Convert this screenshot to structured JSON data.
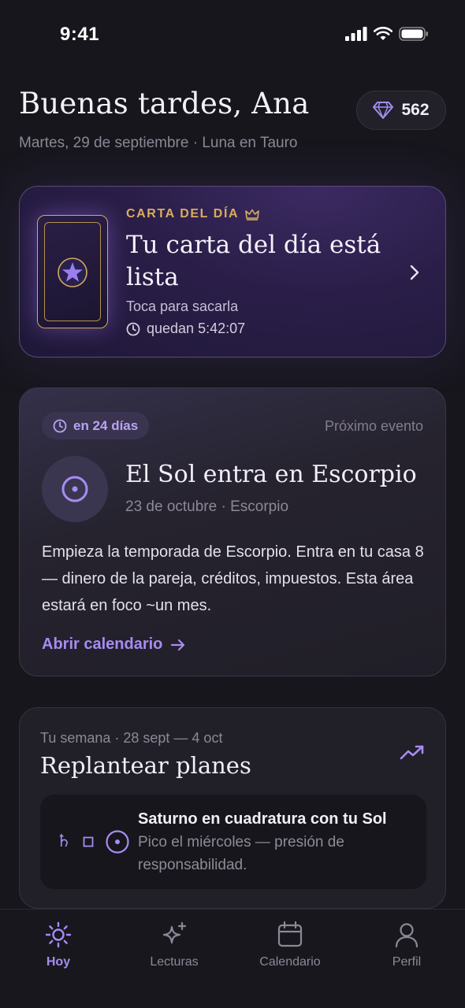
{
  "status_bar": {
    "time": "9:41"
  },
  "header": {
    "greeting": "Buenas tardes, Ana",
    "date_line": "Martes, 29 de septiembre · Luna en Tauro",
    "gems": "562"
  },
  "daily_card": {
    "kicker": "CARTA DEL DÍA",
    "title": "Tu carta del día está lista",
    "subtitle": "Toca para sacarla",
    "timer": "quedan 5:42:07"
  },
  "event_card": {
    "badge": "en 24 días",
    "kind": "Próximo evento",
    "title": "El Sol entra en Escorpio",
    "meta": "23 de octubre · Escorpio",
    "description": "Empieza la temporada de Escorpio. Entra en tu casa 8 — dinero de la pareja, créditos, impuestos. Esta área estará en foco ~un mes.",
    "link": "Abrir calendario"
  },
  "week_card": {
    "range": "Tu semana · 28 sept — 4 oct",
    "title": "Replantear planes",
    "transit": {
      "symbols": [
        "♄",
        "□",
        "☉"
      ],
      "title": "Saturno en cuadratura con tu Sol",
      "description": "Pico el miércoles — presión de responsabilidad."
    }
  },
  "nav": {
    "items": [
      {
        "label": "Hoy",
        "icon": "sun-icon",
        "active": true
      },
      {
        "label": "Lecturas",
        "icon": "sparkle-icon",
        "active": false
      },
      {
        "label": "Calendario",
        "icon": "calendar-icon",
        "active": false
      },
      {
        "label": "Perfil",
        "icon": "user-icon",
        "active": false
      }
    ]
  },
  "colors": {
    "accent": "#a68cf2",
    "gold": "#d9ad5e",
    "background": "#17161d"
  }
}
